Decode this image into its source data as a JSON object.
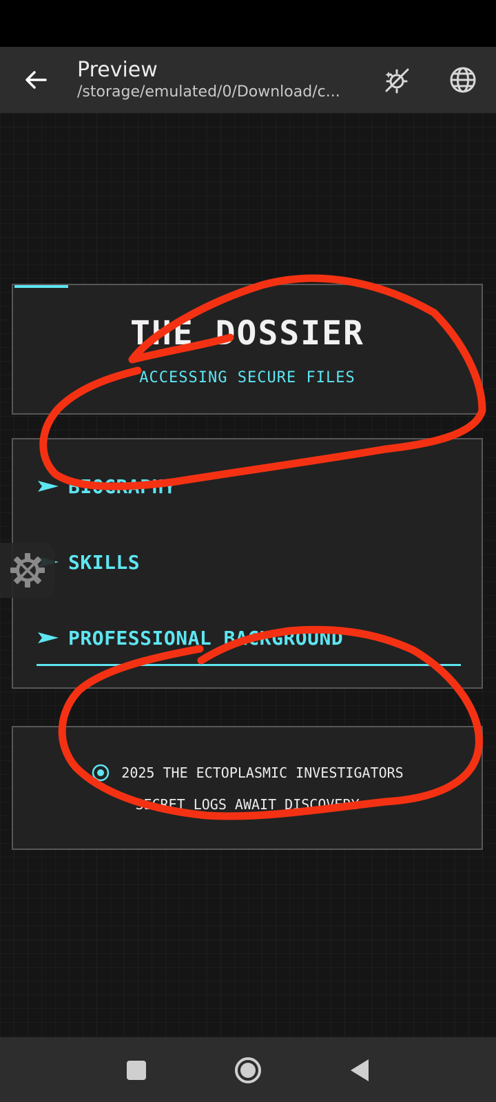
{
  "app_bar": {
    "title": "Preview",
    "path": "/storage/emulated/0/Download/c..."
  },
  "icons": {
    "back": "arrow-left-icon",
    "theme": "auto-theme-icon",
    "browser": "globe-icon",
    "tool": "settings-wrench-icon"
  },
  "page": {
    "header": {
      "title": "THE DOSSIER",
      "subtitle": "ACCESSING SECURE FILES"
    },
    "nav": {
      "items": [
        {
          "label": "BIOGRAPHY"
        },
        {
          "label": "SKILLS"
        },
        {
          "label": "PROFESSIONAL BACKGROUND"
        }
      ]
    },
    "footer": {
      "line1": "2025 THE ECTOPLASMIC INVESTIGATORS",
      "line2": "SECRET LOGS AWAIT DISCOVERY"
    }
  },
  "colors": {
    "accent": "#5ee6f2",
    "annotation": "#f43213",
    "panel_bg": "#222222",
    "page_bg": "#151515"
  }
}
